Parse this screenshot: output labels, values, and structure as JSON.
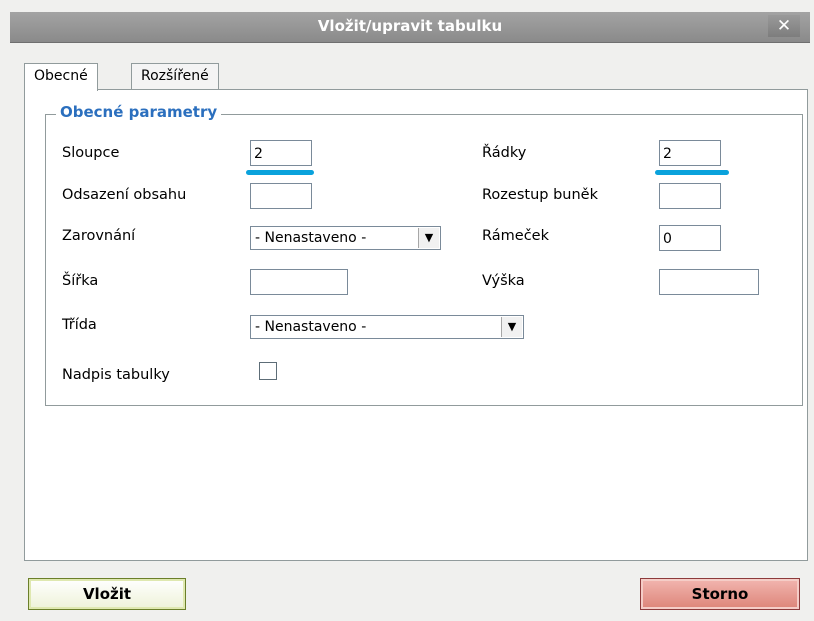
{
  "window": {
    "title": "Vložit/upravit tabulku",
    "close_glyph": "✕"
  },
  "tabs": [
    {
      "label": "Obecné"
    },
    {
      "label": "Rozšířené"
    }
  ],
  "general": {
    "legend": "Obecné parametry",
    "columns": {
      "label": "Sloupce",
      "value": "2"
    },
    "rows": {
      "label": "Řádky",
      "value": "2"
    },
    "cellpadding": {
      "label": "Odsazení obsahu",
      "value": ""
    },
    "cellspacing": {
      "label": "Rozestup buněk",
      "value": ""
    },
    "align": {
      "label": "Zarovnání",
      "value": "- Nenastaveno -"
    },
    "border": {
      "label": "Rámeček",
      "value": "0"
    },
    "width": {
      "label": "Šířka",
      "value": ""
    },
    "height": {
      "label": "Výška",
      "value": ""
    },
    "class": {
      "label": "Třída",
      "value": "- Nenastaveno -"
    },
    "caption": {
      "label": "Nadpis tabulky",
      "checked": false
    }
  },
  "buttons": {
    "insert": "Vložit",
    "cancel": "Storno"
  },
  "colors": {
    "accent_underline": "#0aa2dc",
    "legend": "#2b6fbe",
    "insert_border": "#6b7f2a",
    "cancel_bg": "#dd8478"
  },
  "icons": {
    "close": "close-icon",
    "dropdown": "chevron-down-icon"
  }
}
